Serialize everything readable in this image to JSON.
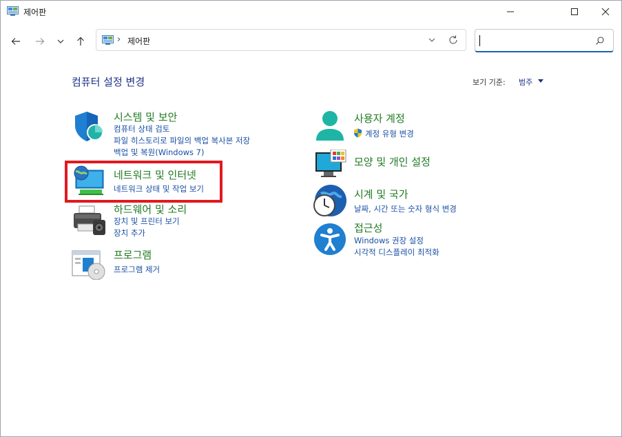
{
  "window": {
    "title": "제어판"
  },
  "nav": {
    "back_icon": "arrow-left-icon",
    "forward_icon": "arrow-right-icon",
    "recent_icon": "chevron-down-icon",
    "up_icon": "arrow-up-icon",
    "breadcrumb_sep": "›",
    "breadcrumb": "제어판",
    "search_value": ""
  },
  "page": {
    "heading": "컴퓨터 설정 변경",
    "view_by_label": "보기 기준:",
    "view_by_value": "범주"
  },
  "categories": [
    {
      "title": "시스템 및 보안",
      "icon": "shield-icon",
      "links": [
        "컴퓨터 상태 검토",
        "파일 히스토리로 파일의 백업 복사본 저장",
        "백업 및 복원(Windows 7)"
      ]
    },
    {
      "title": "네트워크 및 인터넷",
      "icon": "network-globe-icon",
      "links": [
        "네트워크 상태 및 작업 보기"
      ]
    },
    {
      "title": "하드웨어 및 소리",
      "icon": "printer-icon",
      "links": [
        "장치 및 프린터 보기",
        "장치 추가"
      ]
    },
    {
      "title": "프로그램",
      "icon": "programs-disc-icon",
      "links": [
        "프로그램 제거"
      ]
    },
    {
      "title": "사용자 계정",
      "icon": "user-icon",
      "links": [
        "계정 유형 변경"
      ]
    },
    {
      "title": "모양 및 개인 설정",
      "icon": "monitor-personalize-icon",
      "links": []
    },
    {
      "title": "시계 및 국가",
      "icon": "clock-globe-icon",
      "links": [
        "날짜, 시간 또는 숫자 형식 변경"
      ]
    },
    {
      "title": "접근성",
      "icon": "accessibility-icon",
      "links": [
        "Windows 권장 설정",
        "시각적 디스플레이 최적화"
      ]
    }
  ],
  "colors": {
    "category_title": "#217a23",
    "link": "#1a4fa3",
    "heading": "#1e3287",
    "highlight": "#e0191f"
  }
}
